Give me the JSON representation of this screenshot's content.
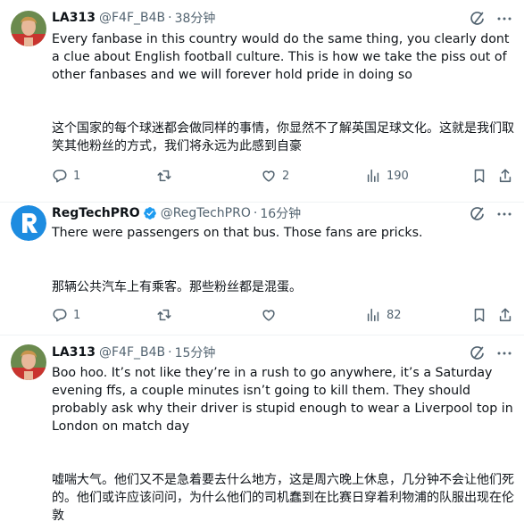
{
  "tweets": [
    {
      "author": "LA313",
      "handle": "@F4F_B4B",
      "separator": "·",
      "time": "38分钟",
      "text_en": "Every fanbase in this country would do the same thing, you clearly dont a clue about English football culture. This is how we take the piss out of other fanbases and we will forever hold pride in doing so",
      "text_zh": "这个国家的每个球迷都会做同样的事情，你显然不了解英国足球文化。这就是我们取笑其他粉丝的方式，我们将永远为此感到自豪",
      "replies": "1",
      "likes": "2",
      "views": "190"
    },
    {
      "author": "RegTechPRO",
      "handle": "@RegTechPRO",
      "separator": "·",
      "time": "16分钟",
      "text_en": "There were passengers on that bus.  Those fans are pricks.",
      "text_zh": "那辆公共汽车上有乘客。那些粉丝都是混蛋。",
      "replies": "1",
      "views": "82"
    },
    {
      "author": "LA313",
      "handle": "@F4F_B4B",
      "separator": "·",
      "time": "15分钟",
      "text_en": "Boo hoo. It’s not like they’re in a rush to go anywhere, it’s a Saturday evening ffs, a couple minutes isn’t going to kill them. They should probably ask why their driver is stupid enough to wear a Liverpool top in London on match day",
      "text_zh": "嘘喘大气。他们又不是急着要去什么地方，这是周六晚上休息，几分钟不会让他们死的。他们或许应该问问，为什么他们的司机蠢到在比赛日穿着利物浦的队服出现在伦敦"
    }
  ],
  "icons": {
    "reply": "reply-icon",
    "retweet": "retweet-icon",
    "like": "heart-icon",
    "views": "views-icon",
    "bookmark": "bookmark-icon",
    "share": "share-icon",
    "grok": "grok-icon",
    "more": "more-icon",
    "verified": "verified-badge-icon"
  },
  "colors": {
    "text": "#0f1419",
    "secondary": "#536471",
    "verified": "#1d9bf0",
    "regtech_avatar": "#1d8ce0",
    "divider": "#eff3f4"
  }
}
